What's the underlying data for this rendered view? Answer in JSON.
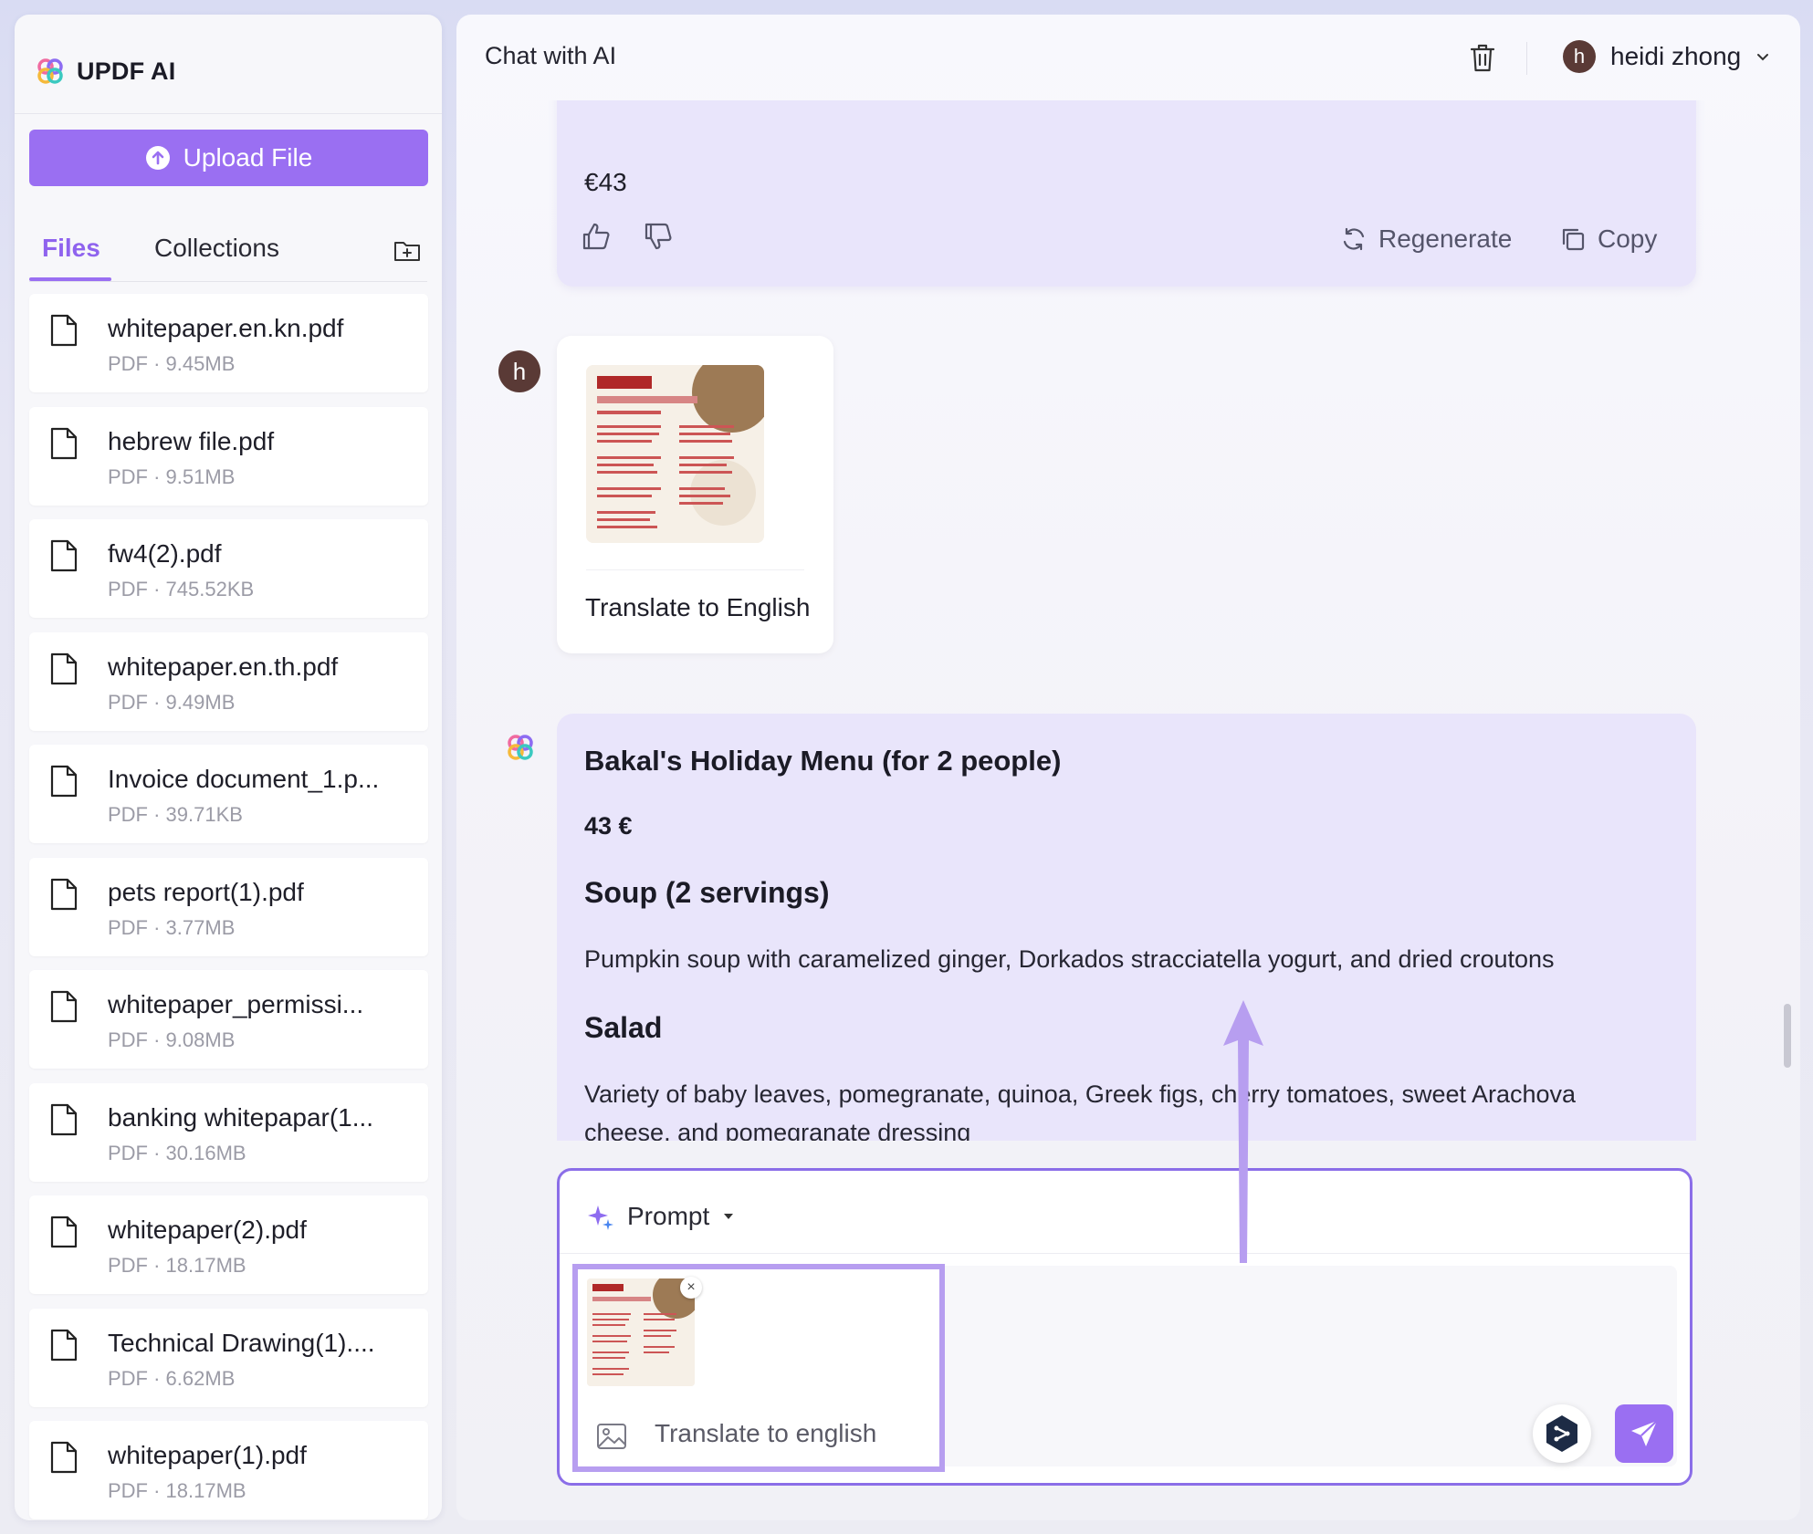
{
  "app": {
    "name": "UPDF AI"
  },
  "sidebar": {
    "upload_label": "Upload File",
    "tabs": [
      {
        "label": "Files"
      },
      {
        "label": "Collections"
      }
    ],
    "files": [
      {
        "name": "whitepaper.en.kn.pdf",
        "meta": "PDF · 9.45MB"
      },
      {
        "name": "hebrew file.pdf",
        "meta": "PDF · 9.51MB"
      },
      {
        "name": "fw4(2).pdf",
        "meta": "PDF · 745.52KB"
      },
      {
        "name": "whitepaper.en.th.pdf",
        "meta": "PDF · 9.49MB"
      },
      {
        "name": "Invoice document_1.p...",
        "meta": "PDF · 39.71KB"
      },
      {
        "name": "pets report(1).pdf",
        "meta": "PDF · 3.77MB"
      },
      {
        "name": "whitepaper_permissi...",
        "meta": "PDF · 9.08MB"
      },
      {
        "name": "banking whitepapar(1...",
        "meta": "PDF · 30.16MB"
      },
      {
        "name": "whitepaper(2).pdf",
        "meta": "PDF · 18.17MB"
      },
      {
        "name": "Technical Drawing(1)....",
        "meta": "PDF · 6.62MB"
      },
      {
        "name": "whitepaper(1).pdf",
        "meta": "PDF · 18.17MB"
      }
    ]
  },
  "header": {
    "title": "Chat with AI",
    "user_initial": "h",
    "user_name": "heidi zhong"
  },
  "chat": {
    "prev_answer": {
      "price": "€43",
      "regenerate_label": "Regenerate",
      "copy_label": "Copy"
    },
    "user_message": {
      "avatar_initial": "h",
      "text": "Translate to English"
    },
    "ai_answer": {
      "title": "Bakal's Holiday Menu (for 2 people)",
      "price": "43 €",
      "section1_title": "Soup (2 servings)",
      "section1_text": "Pumpkin soup with caramelized ginger, Dorkados stracciatella yogurt, and dried croutons",
      "section2_title": "Salad",
      "section2_text_line1": "Variety of baby leaves, pomegranate, quinoa, Greek figs, cherry tomatoes, sweet Arachova",
      "section2_text_line2": "cheese, and pomegranate dressing"
    }
  },
  "composer": {
    "prompt_label": "Prompt",
    "attachment_text": "Translate to english"
  },
  "colors": {
    "accent": "#9a6ff2",
    "ai_bubble": "#e9e5fb",
    "avatar": "#5a3a36"
  }
}
